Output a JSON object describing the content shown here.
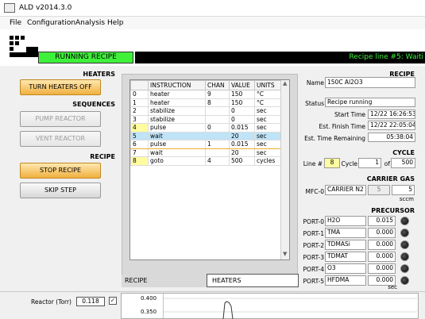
{
  "window": {
    "title": "ALD v2014.3.0"
  },
  "menu": [
    "File",
    "Configuration",
    "Analysis",
    "Help"
  ],
  "status": {
    "running": "RUNNING RECIPE",
    "line": "Recipe line #5: Waiti"
  },
  "left": {
    "heaters_label": "HEATERS",
    "heaters_button": "TURN HEATERS OFF",
    "sequences_label": "SEQUENCES",
    "pump_button": "PUMP REACTOR",
    "vent_button": "VENT REACTOR",
    "recipe_label": "RECIPE",
    "stop_button": "STOP RECIPE",
    "skip_button": "SKIP STEP"
  },
  "table": {
    "headers": [
      "",
      "INSTRUCTION",
      "CHAN",
      "VALUE",
      "UNITS"
    ],
    "rows": [
      [
        "0",
        "heater",
        "9",
        "150",
        "°C"
      ],
      [
        "1",
        "heater",
        "8",
        "150",
        "°C"
      ],
      [
        "2",
        "stabilize",
        "",
        "0",
        "sec"
      ],
      [
        "3",
        "stabilize",
        "",
        "0",
        "sec"
      ],
      [
        "4",
        "pulse",
        "0",
        "0.015",
        "sec"
      ],
      [
        "5",
        "wait",
        "",
        "20",
        "sec"
      ],
      [
        "6",
        "pulse",
        "1",
        "0.015",
        "sec"
      ],
      [
        "7",
        "wait",
        "",
        "20",
        "sec"
      ],
      [
        "8",
        "goto",
        "4",
        "500",
        "cycles"
      ]
    ]
  },
  "tabs": {
    "recipe": "RECIPE",
    "heaters": "HEATERS"
  },
  "recipe": {
    "section": "RECIPE",
    "name_label": "Name",
    "name": "150C Al2O3",
    "status_label": "Status",
    "status": "Recipe running",
    "start_label": "Start Time",
    "start": "12/22 16:26:53",
    "finish_label": "Est. Finish Time",
    "finish": "12/22 22:05:04",
    "remaining_label": "Est. Time Remaining",
    "remaining": "05:38:04"
  },
  "cycle": {
    "section": "CYCLE",
    "line_label": "Line #",
    "line": "8",
    "cycle_label": "Cycle",
    "cycle": "1",
    "of_label": "of",
    "total": "500"
  },
  "carrier": {
    "section": "CARRIER GAS",
    "mfc_label": "MFC-0",
    "gas": "CARRIER N2",
    "val1": "5",
    "val2": "5",
    "unit": "sccm"
  },
  "precursor": {
    "section": "PRECURSOR",
    "ports": [
      {
        "label": "PORT-0",
        "name": "H2O",
        "value": "0.015"
      },
      {
        "label": "PORT-1",
        "name": "TMA",
        "value": "0.000"
      },
      {
        "label": "PORT-2",
        "name": "TDMASi",
        "value": "0.000"
      },
      {
        "label": "PORT-3",
        "name": "TDMAT",
        "value": "0.000"
      },
      {
        "label": "PORT-4",
        "name": "O3",
        "value": "0.000"
      },
      {
        "label": "PORT-5",
        "name": "HFDMA",
        "value": "0.000"
      }
    ],
    "unit": "sec"
  },
  "bottom": {
    "reactor_label": "Reactor (Torr)",
    "reactor_value": "0.118",
    "ticks": [
      "0.400",
      "0.350"
    ]
  }
}
